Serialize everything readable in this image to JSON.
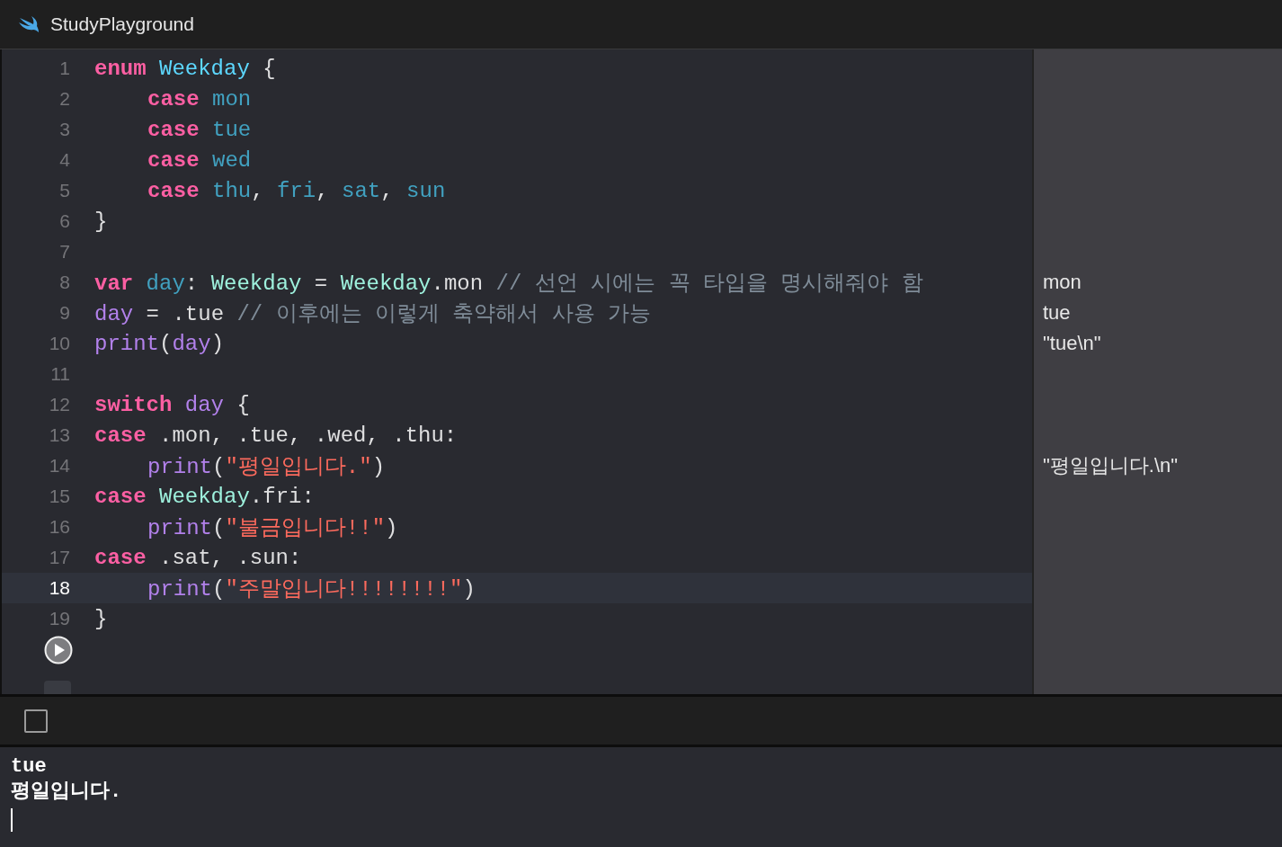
{
  "window": {
    "title": "StudyPlayground"
  },
  "editor": {
    "lines": [
      {
        "number": "1",
        "current": false,
        "indented": false,
        "tokens": [
          {
            "kind": "keyword",
            "text": "enum"
          },
          {
            "kind": "typedecl",
            "text": "Weekday"
          },
          {
            "kind": "plain",
            "text": " {"
          }
        ]
      },
      {
        "number": "2",
        "current": false,
        "indented": true,
        "tokens": [
          {
            "kind": "keyword",
            "text": "case"
          },
          {
            "kind": "decl",
            "text": "mon"
          }
        ]
      },
      {
        "number": "3",
        "current": false,
        "indented": true,
        "tokens": [
          {
            "kind": "keyword",
            "text": "case"
          },
          {
            "kind": "decl",
            "text": "tue"
          }
        ]
      },
      {
        "number": "4",
        "current": false,
        "indented": true,
        "tokens": [
          {
            "kind": "keyword",
            "text": "case"
          },
          {
            "kind": "decl",
            "text": "wed"
          }
        ]
      },
      {
        "number": "5",
        "current": false,
        "indented": true,
        "tokens": [
          {
            "kind": "keyword",
            "text": "case"
          },
          {
            "kind": "decl",
            "text": "thu"
          },
          {
            "kind": "plain",
            "text": ", "
          },
          {
            "kind": "decl",
            "text": "fri"
          },
          {
            "kind": "plain",
            "text": ", "
          },
          {
            "kind": "decl",
            "text": "sat"
          },
          {
            "kind": "plain",
            "text": ", "
          },
          {
            "kind": "decl",
            "text": "sun"
          }
        ]
      },
      {
        "number": "6",
        "current": false,
        "indented": false,
        "tokens": [
          {
            "kind": "plain",
            "text": "}"
          }
        ]
      },
      {
        "number": "7",
        "current": false
      },
      {
        "number": "8",
        "current": false,
        "indented": false,
        "tokens": [
          {
            "kind": "keyword",
            "text": "var"
          },
          {
            "kind": "decl",
            "text": "day"
          },
          {
            "kind": "plain",
            "text": ": "
          },
          {
            "kind": "type",
            "text": "Weekday"
          },
          {
            "kind": "plain",
            "text": " = "
          },
          {
            "kind": "type",
            "text": "Weekday"
          },
          {
            "kind": "plain",
            "text": ".mon "
          },
          {
            "kind": "comment",
            "text": "// 선언 시에는 꼭 타입을 명시해줘야 함"
          }
        ],
        "result": "mon"
      },
      {
        "number": "9",
        "current": false,
        "indented": false,
        "tokens": [
          {
            "kind": "ident",
            "text": "day"
          },
          {
            "kind": "plain",
            "text": " = .tue "
          },
          {
            "kind": "comment",
            "text": "// 이후에는 이렇게 축약해서 사용 가능"
          }
        ],
        "result": "tue"
      },
      {
        "number": "10",
        "current": false,
        "indented": false,
        "tokens": [
          {
            "kind": "ident",
            "text": "print"
          },
          {
            "kind": "plain",
            "text": "("
          },
          {
            "kind": "ident",
            "text": "day"
          },
          {
            "kind": "plain",
            "text": ")"
          }
        ],
        "result": "\"tue\\n\""
      },
      {
        "number": "11",
        "current": false
      },
      {
        "number": "12",
        "current": false,
        "indented": false,
        "tokens": [
          {
            "kind": "keyword",
            "text": "switch"
          },
          {
            "kind": "ident",
            "text": "day"
          },
          {
            "kind": "plain",
            "text": " {"
          }
        ]
      },
      {
        "number": "13",
        "current": false,
        "indented": false,
        "tokens": [
          {
            "kind": "keyword",
            "text": "case"
          },
          {
            "kind": "plain",
            "text": ".mon, .tue, .wed, .thu:"
          }
        ]
      },
      {
        "number": "14",
        "current": false,
        "indented": true,
        "tokens": [
          {
            "kind": "ident",
            "text": "print"
          },
          {
            "kind": "plain",
            "text": "("
          },
          {
            "kind": "string",
            "text": "\"평일입니다.\""
          },
          {
            "kind": "plain",
            "text": ")"
          }
        ],
        "result": "\"평일입니다.\\n\""
      },
      {
        "number": "15",
        "current": false,
        "indented": false,
        "tokens": [
          {
            "kind": "keyword",
            "text": "case"
          },
          {
            "kind": "type",
            "text": "Weekday"
          },
          {
            "kind": "plain",
            "text": ".fri:"
          }
        ]
      },
      {
        "number": "16",
        "current": false,
        "indented": true,
        "tokens": [
          {
            "kind": "ident",
            "text": "print"
          },
          {
            "kind": "plain",
            "text": "("
          },
          {
            "kind": "string",
            "text": "\"불금입니다!!\""
          },
          {
            "kind": "plain",
            "text": ")"
          }
        ]
      },
      {
        "number": "17",
        "current": false,
        "indented": false,
        "tokens": [
          {
            "kind": "keyword",
            "text": "case"
          },
          {
            "kind": "plain",
            "text": ".sat, .sun:"
          }
        ]
      },
      {
        "number": "18",
        "current": true,
        "indented": true,
        "tokens": [
          {
            "kind": "ident",
            "text": "print"
          },
          {
            "kind": "plain",
            "text": "("
          },
          {
            "kind": "string",
            "text": "\"주말입니다!!!!!!!!\""
          },
          {
            "kind": "plain",
            "text": ")"
          }
        ]
      },
      {
        "number": "19",
        "current": false,
        "indented": false,
        "tokens": [
          {
            "kind": "plain",
            "text": "}"
          }
        ]
      }
    ]
  },
  "console": {
    "lines": [
      "tue",
      "평일입니다."
    ]
  }
}
